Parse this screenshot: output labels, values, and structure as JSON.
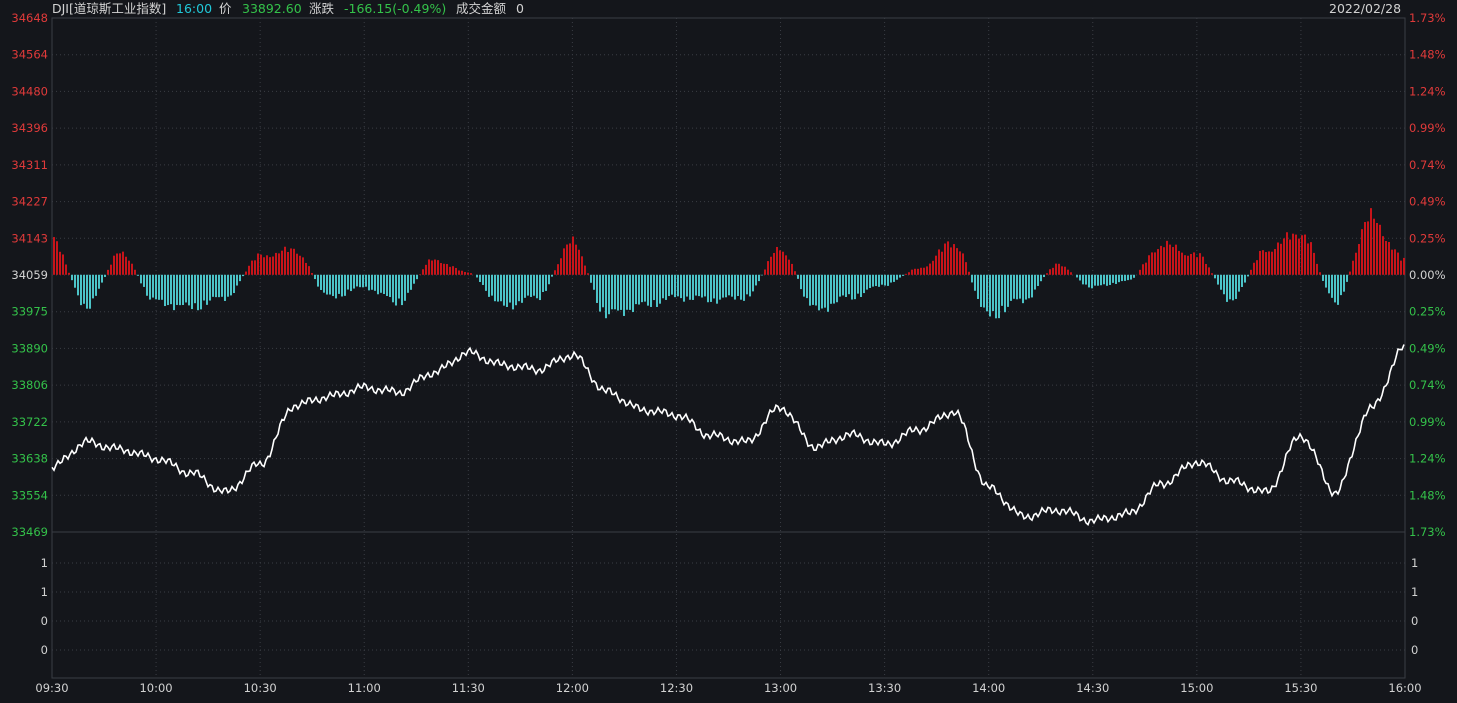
{
  "header": {
    "symbol": "DJI[道琼斯工业指数]",
    "time": "16:00",
    "price_label": "价",
    "price": "33892.60",
    "change_label": "涨跌",
    "change": "-166.15(-0.49%)",
    "amount_label": "成交金额",
    "amount": "0",
    "date": "2022/02/28"
  },
  "colors": {
    "background": "#14161b",
    "grid": "#3a3d44",
    "up": "#c8141a",
    "down": "#4cc4c8",
    "price_line": "#ffffff",
    "up_text": "#e03a3a",
    "down_text": "#34c24a"
  },
  "chart_data": {
    "type": "line",
    "reference_price": 34059,
    "y_ticks": [
      "34648",
      "34564",
      "34480",
      "34396",
      "34311",
      "34227",
      "34143",
      "34059",
      "33975",
      "33890",
      "33806",
      "33722",
      "33638",
      "33554",
      "33469"
    ],
    "pct_ticks": [
      "1.73%",
      "1.48%",
      "1.24%",
      "0.99%",
      "0.74%",
      "0.49%",
      "0.25%",
      "0.00%",
      "0.25%",
      "0.49%",
      "0.74%",
      "0.99%",
      "1.24%",
      "1.48%",
      "1.73%"
    ],
    "ylim": [
      33469,
      34648
    ],
    "x_ticks": [
      "09:30",
      "10:00",
      "10:30",
      "11:00",
      "11:30",
      "12:00",
      "12:30",
      "13:00",
      "13:30",
      "14:00",
      "14:30",
      "15:00",
      "15:30",
      "16:00"
    ],
    "volume_ticks": [
      "1",
      "1",
      "0",
      "0"
    ],
    "series": [
      {
        "type": "line",
        "x": [
          "09:30",
          "09:40",
          "09:50",
          "10:00",
          "10:10",
          "10:20",
          "10:30",
          "10:40",
          "10:50",
          "11:00",
          "11:10",
          "11:20",
          "11:30",
          "11:40",
          "11:50",
          "12:00",
          "12:10",
          "12:20",
          "12:30",
          "12:40",
          "12:50",
          "13:00",
          "13:10",
          "13:20",
          "13:30",
          "13:40",
          "13:50",
          "14:00",
          "14:10",
          "14:20",
          "14:30",
          "14:40",
          "14:50",
          "15:00",
          "15:10",
          "15:20",
          "15:30",
          "15:40",
          "15:50",
          "16:00"
        ],
        "values": [
          33618,
          33675,
          33658,
          33638,
          33605,
          33560,
          33625,
          33760,
          33780,
          33800,
          33790,
          33835,
          33880,
          33852,
          33842,
          33875,
          33790,
          33750,
          33738,
          33690,
          33675,
          33755,
          33665,
          33692,
          33670,
          33705,
          33745,
          33570,
          33505,
          33520,
          33495,
          33510,
          33580,
          33630,
          33585,
          33560,
          33690,
          33560,
          33750,
          33892
        ]
      },
      {
        "type": "bar",
        "name": "pct_change_bars",
        "x": [
          "09:30",
          "09:40",
          "09:50",
          "10:00",
          "10:10",
          "10:20",
          "10:30",
          "10:40",
          "10:50",
          "11:00",
          "11:10",
          "11:20",
          "11:30",
          "11:40",
          "11:50",
          "12:00",
          "12:10",
          "12:20",
          "12:30",
          "12:40",
          "12:50",
          "13:00",
          "13:10",
          "13:20",
          "13:30",
          "13:40",
          "13:50",
          "14:00",
          "14:10",
          "14:20",
          "14:30",
          "14:40",
          "14:50",
          "15:00",
          "15:10",
          "15:20",
          "15:30",
          "15:40",
          "15:50",
          "16:00"
        ],
        "values": [
          0.27,
          -0.25,
          0.18,
          -0.22,
          -0.26,
          -0.18,
          0.15,
          0.2,
          -0.18,
          -0.1,
          -0.22,
          0.12,
          0.02,
          -0.25,
          -0.18,
          0.26,
          -0.32,
          -0.25,
          -0.18,
          -0.2,
          -0.18,
          0.21,
          -0.28,
          -0.18,
          -0.08,
          0.05,
          0.26,
          -0.33,
          -0.2,
          0.08,
          -0.1,
          -0.05,
          0.24,
          0.16,
          -0.2,
          0.2,
          0.34,
          -0.22,
          0.45,
          0.12
        ]
      }
    ]
  }
}
